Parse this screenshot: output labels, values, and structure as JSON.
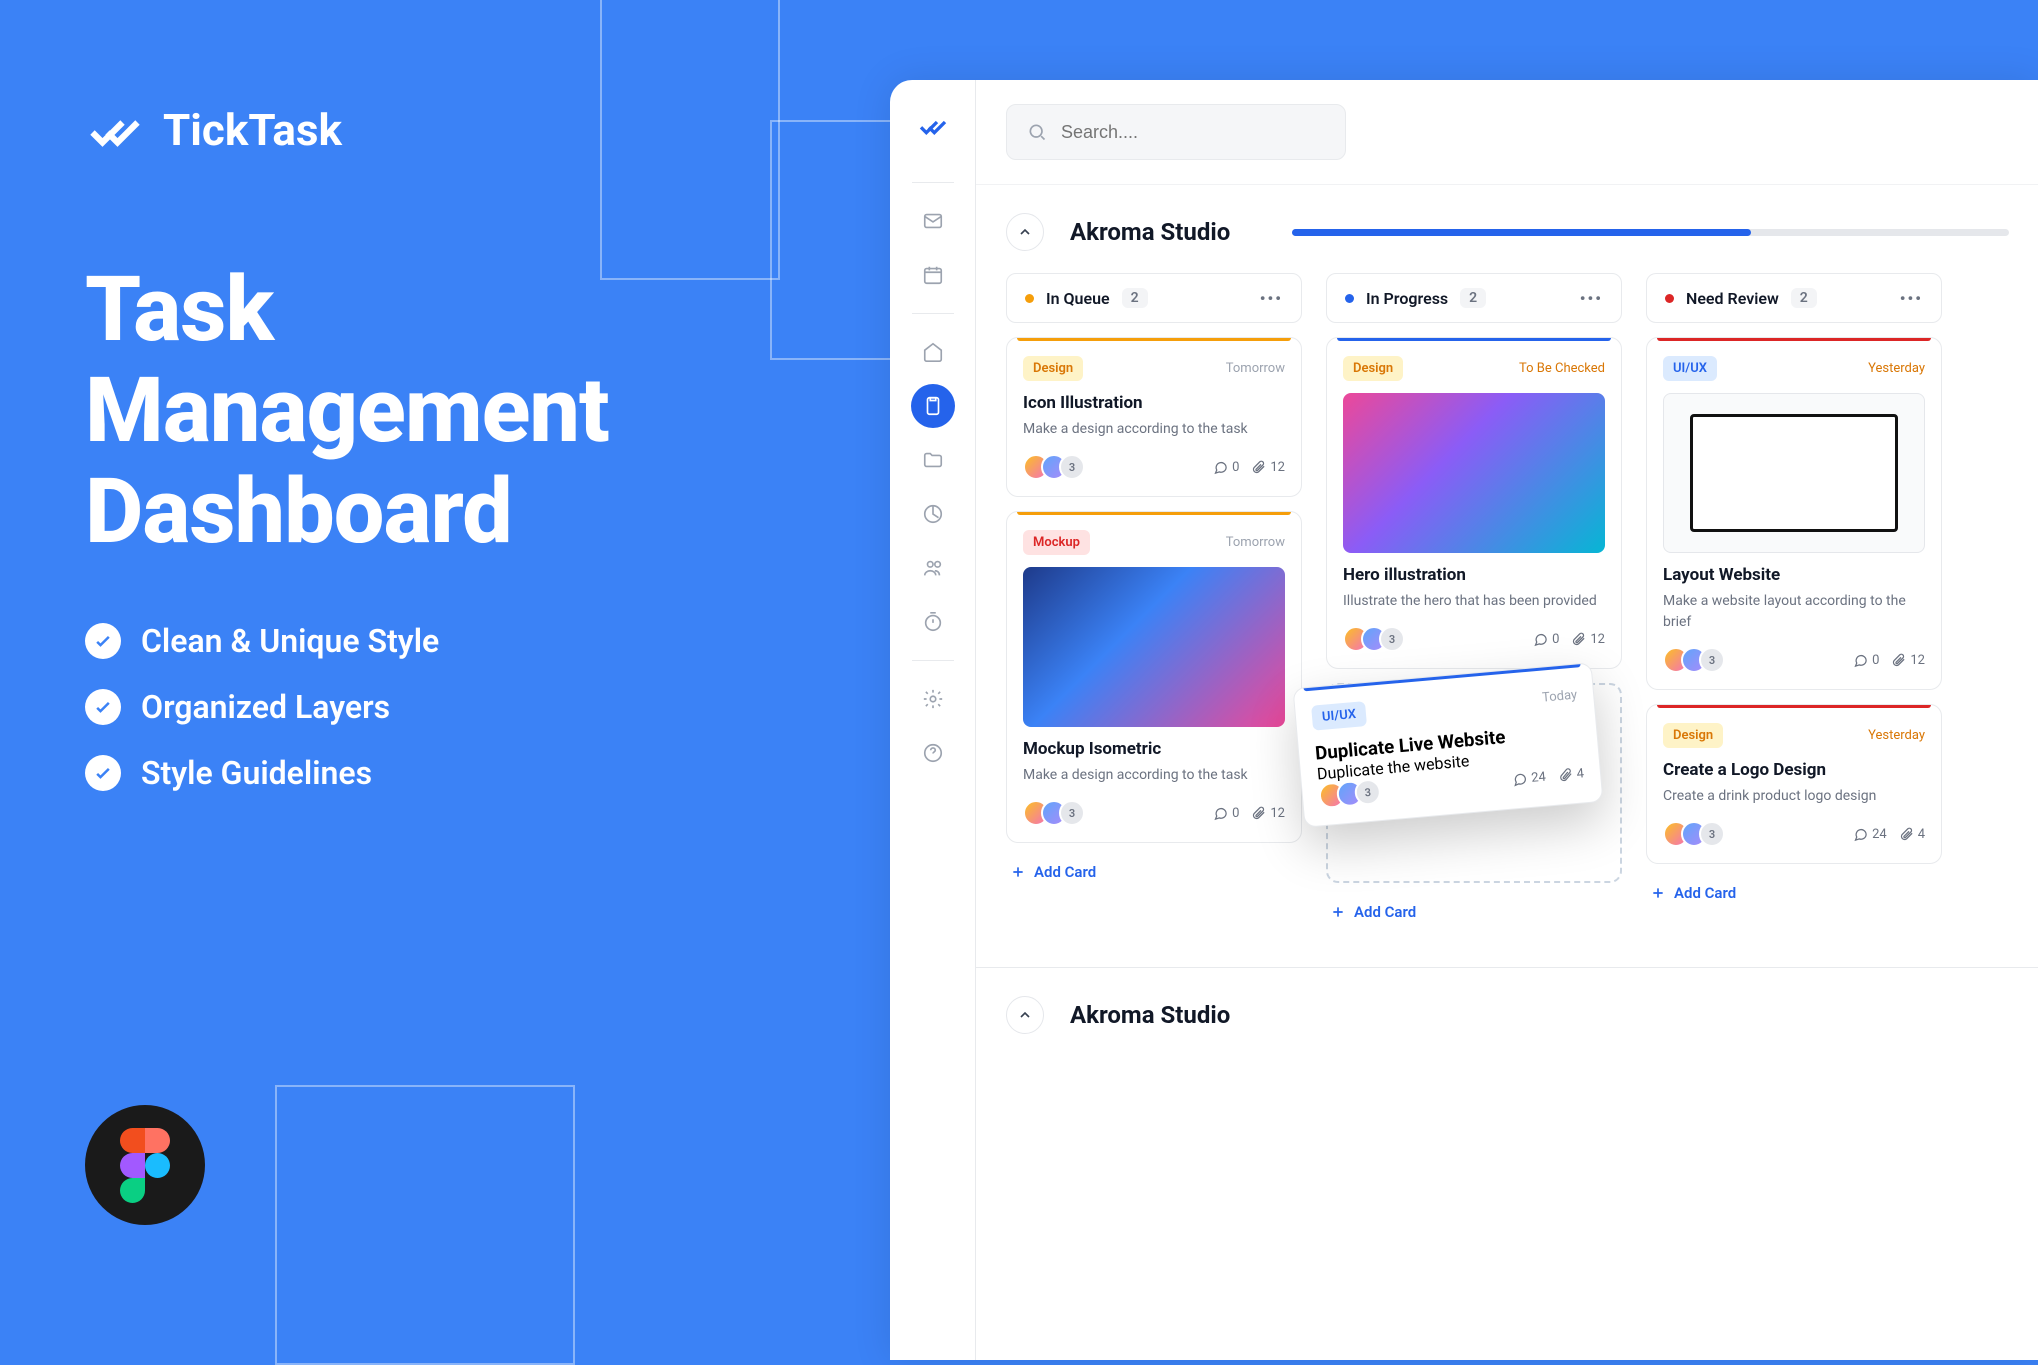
{
  "promo": {
    "brand": "TickTask",
    "heading_l1": "Task",
    "heading_l2": "Management",
    "heading_l3": "Dashboard",
    "features": [
      "Clean & Unique Style",
      "Organized Layers",
      "Style Guidelines"
    ]
  },
  "search": {
    "placeholder": "Search...."
  },
  "project": {
    "title": "Akroma Studio",
    "progress_pct": 64
  },
  "project2": {
    "title": "Akroma Studio"
  },
  "columns": [
    {
      "id": "queue",
      "title": "In Queue",
      "count": "2",
      "color": "#f59e0b",
      "cards": [
        {
          "tag": "Design",
          "tag_class": "design",
          "due": "Tomorrow",
          "due_class": "",
          "title": "Icon Illustration",
          "desc": "Make a design according to the task",
          "comments": "0",
          "attachments": "12",
          "extra": "3",
          "stripe": "#f59e0b"
        },
        {
          "tag": "Mockup",
          "tag_class": "mockup",
          "due": "Tomorrow",
          "due_class": "",
          "title": "Mockup Isometric",
          "desc": "Make a design according to the task",
          "comments": "0",
          "attachments": "12",
          "extra": "3",
          "stripe": "#f59e0b",
          "thumb": "mockup-img"
        }
      ],
      "add": "Add Card"
    },
    {
      "id": "progress",
      "title": "In Progress",
      "count": "2",
      "color": "#2563eb",
      "cards": [
        {
          "tag": "Design",
          "tag_class": "design",
          "due": "To Be Checked",
          "due_class": "warn",
          "title": "Hero illustration",
          "desc": "Illustrate the hero that has been provided",
          "comments": "0",
          "attachments": "12",
          "extra": "3",
          "stripe": "#2563eb",
          "thumb": "hero"
        }
      ],
      "dragging": {
        "tag": "UI/UX",
        "tag_class": "uiux",
        "due": "Today",
        "title": "Duplicate Live Website",
        "desc": "Duplicate the website",
        "comments": "24",
        "attachments": "4",
        "extra": "3"
      },
      "add": "Add Card"
    },
    {
      "id": "review",
      "title": "Need Review",
      "count": "2",
      "color": "#dc2626",
      "cards": [
        {
          "tag": "UI/UX",
          "tag_class": "uiux",
          "due": "Yesterday",
          "due_class": "warn",
          "title": "Layout Website",
          "desc": "Make a website layout according to the brief",
          "comments": "0",
          "attachments": "12",
          "extra": "3",
          "stripe": "#dc2626",
          "thumb": "layout"
        },
        {
          "tag": "Design",
          "tag_class": "design",
          "due": "Yesterday",
          "due_class": "warn",
          "title": "Create a Logo Design",
          "desc": "Create a drink product logo design",
          "comments": "24",
          "attachments": "4",
          "extra": "3",
          "stripe": "#dc2626"
        }
      ],
      "add": "Add Card"
    }
  ]
}
